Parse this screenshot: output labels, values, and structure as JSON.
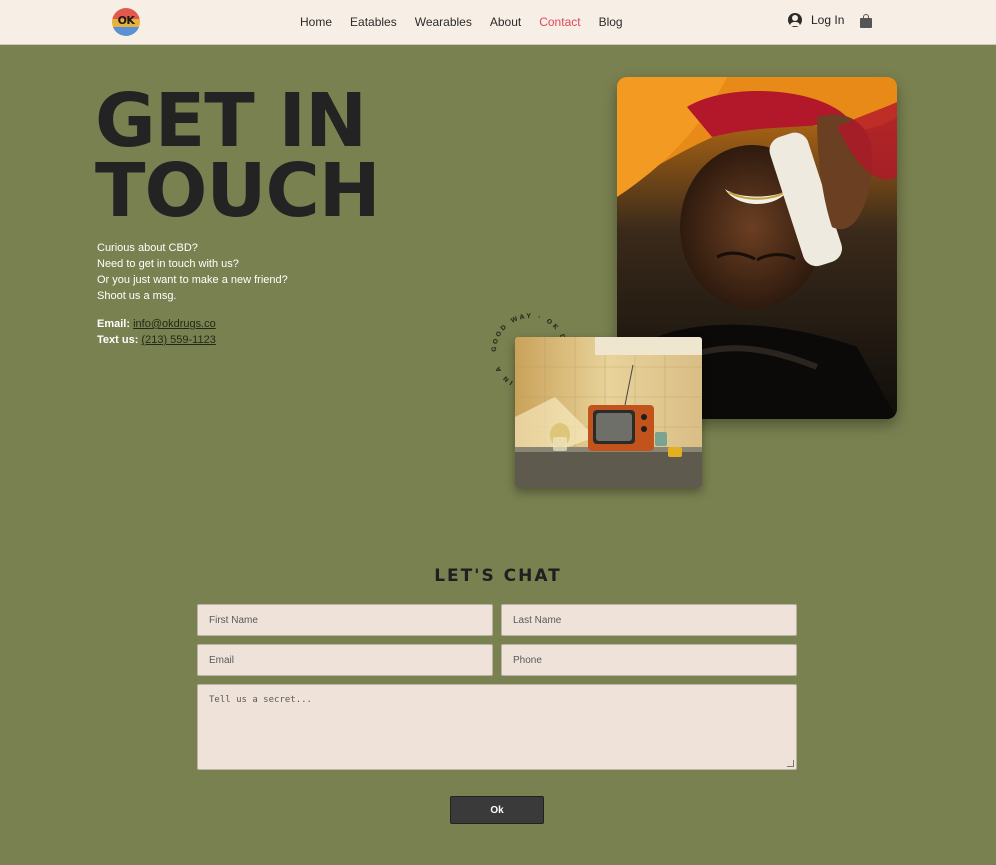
{
  "header": {
    "logo_text": "OK",
    "nav": [
      {
        "label": "Home"
      },
      {
        "label": "Eatables"
      },
      {
        "label": "Wearables"
      },
      {
        "label": "About"
      },
      {
        "label": "Contact",
        "active": true
      },
      {
        "label": "Blog"
      }
    ],
    "login_label": "Log In",
    "active_color": "#e0465b",
    "background": "#f7efe6"
  },
  "hero": {
    "title_line1": "GET IN",
    "title_line2": "TOUCH",
    "intro": [
      "Curious about CBD?",
      "Need to get in touch with us?",
      "Or you just want to make a new friend?",
      "Shoot us a msg."
    ],
    "email_label": "Email:",
    "email_value": "info@okdrugs.co",
    "text_label": "Text us:",
    "text_value": "(213) 559-1123",
    "badge_text": "GOOD WAY · OK DRUGS · CRAZY IN A ",
    "background": "#7a8150"
  },
  "form": {
    "title": "LET'S CHAT",
    "first_name_placeholder": "First Name",
    "last_name_placeholder": "Last Name",
    "email_placeholder": "Email",
    "phone_placeholder": "Phone",
    "message_placeholder": "Tell us a secret...",
    "submit_label": "Ok"
  },
  "icons": {
    "user": "user-circle-icon",
    "cart": "shopping-bag-icon"
  }
}
